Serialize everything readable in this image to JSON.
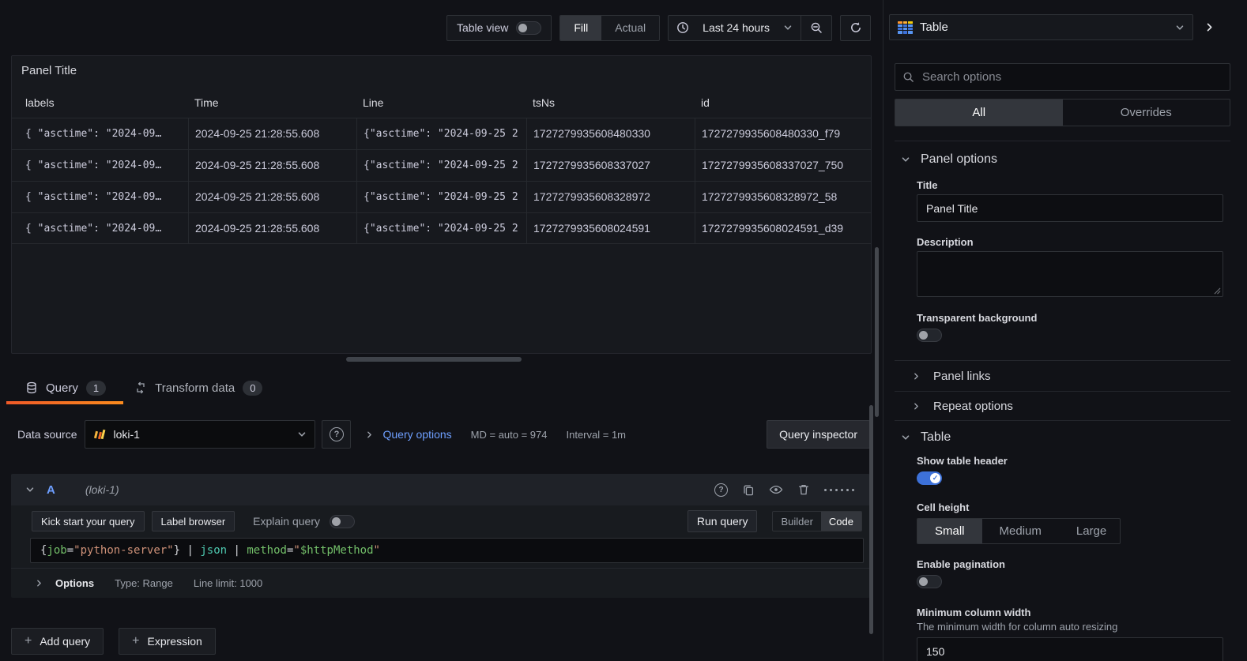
{
  "toolbar": {
    "table_view": "Table view",
    "fill": "Fill",
    "actual": "Actual",
    "time_range": "Last 24 hours"
  },
  "viz_picker": {
    "label": "Table"
  },
  "panel": {
    "title": "Panel Title",
    "columns": [
      "labels",
      "Time",
      "Line",
      "tsNs",
      "id"
    ],
    "rows": [
      [
        "{ \"asctime\": \"2024-09…",
        "2024-09-25 21:28:55.608",
        "{\"asctime\": \"2024-09-25 2",
        "1727279935608480330",
        "1727279935608480330_f79"
      ],
      [
        "{ \"asctime\": \"2024-09…",
        "2024-09-25 21:28:55.608",
        "{\"asctime\": \"2024-09-25 2",
        "1727279935608337027",
        "1727279935608337027_750"
      ],
      [
        "{ \"asctime\": \"2024-09…",
        "2024-09-25 21:28:55.608",
        "{\"asctime\": \"2024-09-25 2",
        "1727279935608328972",
        "1727279935608328972_58"
      ],
      [
        "{ \"asctime\": \"2024-09…",
        "2024-09-25 21:28:55.608",
        "{\"asctime\": \"2024-09-25 2",
        "1727279935608024591",
        "1727279935608024591_d39"
      ]
    ]
  },
  "tabs": {
    "query": "Query",
    "query_count": "1",
    "transform": "Transform data",
    "transform_count": "0"
  },
  "query": {
    "datasource_label": "Data source",
    "datasource_value": "loki-1",
    "help_glyph": "?",
    "options_link": "Query options",
    "md_stat": "MD = auto = 974",
    "interval_stat": "Interval = 1m",
    "inspector": "Query inspector",
    "ref_id": "A",
    "ref_hint": "(loki-1)",
    "kick_start": "Kick start your query",
    "label_browser": "Label browser",
    "explain": "Explain query",
    "run": "Run query",
    "builder": "Builder",
    "code": "Code",
    "expr": [
      {
        "text": "{",
        "cls": "p"
      },
      {
        "text": "job",
        "cls": "k"
      },
      {
        "text": "=",
        "cls": "p"
      },
      {
        "text": "\"python-server\"",
        "cls": "s"
      },
      {
        "text": "}",
        "cls": "p"
      },
      {
        "text": " | ",
        "cls": "p"
      },
      {
        "text": "json",
        "cls": "f"
      },
      {
        "text": " | ",
        "cls": "p"
      },
      {
        "text": "method",
        "cls": "k"
      },
      {
        "text": "=",
        "cls": "p"
      },
      {
        "text": "\"",
        "cls": "s"
      },
      {
        "text": "$httpMethod",
        "cls": "v"
      },
      {
        "text": "\"",
        "cls": "s"
      }
    ],
    "options_label": "Options",
    "options_type": "Type: Range",
    "options_limit": "Line limit: 1000",
    "add_query": "Add query",
    "expression": "Expression",
    "plus_icon": "+"
  },
  "sidebar": {
    "search_placeholder": "Search options",
    "tab_all": "All",
    "tab_overrides": "Overrides",
    "panel_options": {
      "header": "Panel options",
      "title_label": "Title",
      "title_value": "Panel Title",
      "description_label": "Description",
      "transparent_label": "Transparent background",
      "panel_links": "Panel links",
      "repeat_options": "Repeat options"
    },
    "table_section": {
      "header": "Table",
      "show_header_label": "Show table header",
      "cell_height_label": "Cell height",
      "cell_small": "Small",
      "cell_medium": "Medium",
      "cell_large": "Large",
      "pagination_label": "Enable pagination",
      "min_width_label": "Minimum column width",
      "min_width_desc": "The minimum width for column auto resizing",
      "min_width_value": "150"
    }
  },
  "colors": {
    "accent_blue": "#3d71d9",
    "link_blue": "#6e9fff",
    "tab_indicator_orange": "#f05a28",
    "code_green": "#73bf69",
    "code_string_orange": "#ce9178",
    "code_teal": "#4ec9b0",
    "viz_icon_blue": "#5794f2",
    "viz_icon_orange": "#ff9830"
  }
}
